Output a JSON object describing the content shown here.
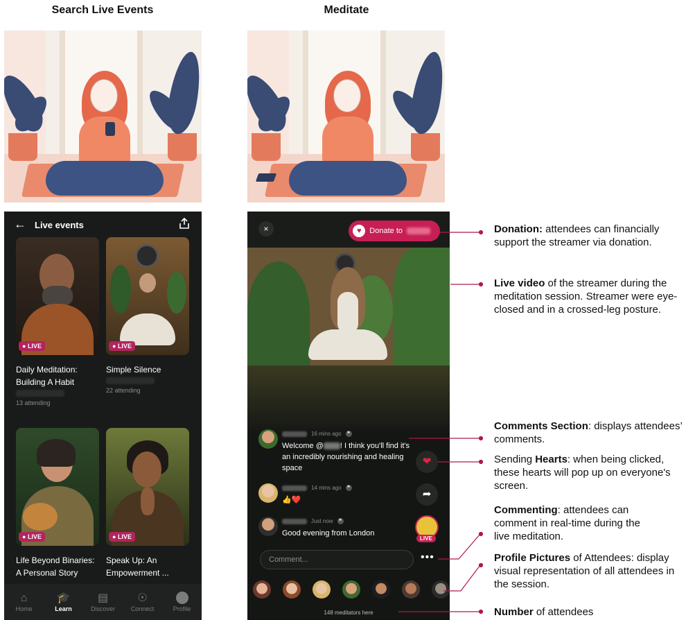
{
  "headings": {
    "left": "Search Live Events",
    "right": "Meditate"
  },
  "left_phone": {
    "header_title": "Live events",
    "back_icon": "arrow-left-icon",
    "share_icon": "share-icon",
    "live_badge": "LIVE",
    "cards": [
      {
        "title": "Daily Meditation: Building A Habit",
        "attending": "13 attending"
      },
      {
        "title": "Simple Silence",
        "attending": "22 attending"
      },
      {
        "title": "Life Beyond Binaries: A Personal Story",
        "attending": ""
      },
      {
        "title": "Speak Up: An Empowerment ...",
        "attending": ""
      }
    ],
    "nav": [
      {
        "label": "Home",
        "icon": "home-icon"
      },
      {
        "label": "Learn",
        "icon": "graduation-cap-icon"
      },
      {
        "label": "Discover",
        "icon": "stack-icon"
      },
      {
        "label": "Connect",
        "icon": "globe-icon"
      },
      {
        "label": "Profile",
        "icon": "avatar-icon"
      }
    ],
    "active_nav": "Learn"
  },
  "right_phone": {
    "close": "×",
    "donate_label": "Donate to",
    "comments": [
      {
        "time": "16 mins ago",
        "text_before": "Welcome @",
        "text_after": "! I think you'll find it's an incredibly nourishing and healing space"
      },
      {
        "time": "14 mins ago",
        "text": "👍❤️"
      },
      {
        "time": "Just now",
        "text": "Good evening from London"
      }
    ],
    "live_badge": "LIVE",
    "comment_placeholder": "Comment...",
    "more": "•••",
    "meditators_count": "148 meditators here"
  },
  "annotations": [
    {
      "bold": "Donation:",
      "text": " attendees can financially support the streamer via donation."
    },
    {
      "bold": "Live video",
      "text": " of the streamer during the meditation session. Streamer were eye-closed and in a crossed-leg posture."
    },
    {
      "bold": "Comments Section",
      "text": ": displays attendees’ comments."
    },
    {
      "pre": "Sending ",
      "bold": "Hearts",
      "text": ": when being clicked, these hearts will pop up on everyone's screen."
    },
    {
      "bold": "Commenting",
      "text": ": attendees can comment in real-time during the live meditation."
    },
    {
      "bold": "Profile Pictures",
      "text": " of Attendees: display visual representation of all attendees in the session."
    },
    {
      "bold": "Number",
      "text": " of attendees"
    }
  ],
  "colors": {
    "accent": "#c71f55",
    "line": "#b0184e",
    "dark_bg": "#191b1a"
  }
}
